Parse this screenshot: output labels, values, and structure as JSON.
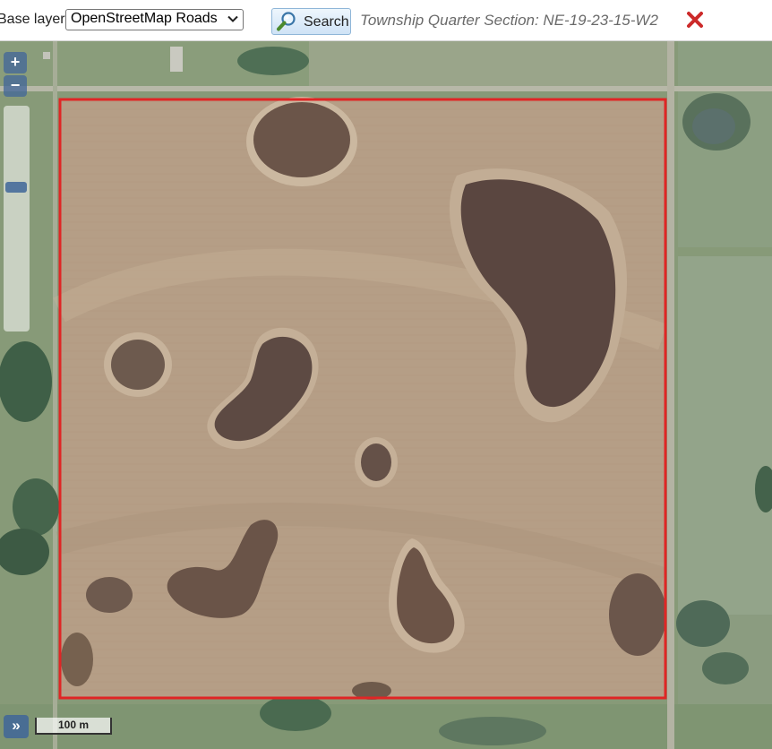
{
  "toolbar": {
    "base_layer_label": "Base layer:",
    "base_layer_selected": "OpenStreetMap Roads",
    "search_label": "Search",
    "section_title": "Township Quarter Section: NE-19-23-15-W2"
  },
  "icons": {
    "search": "magnifier-icon",
    "close": "close-x-icon",
    "select_chevron": "chevron-down-icon"
  },
  "map": {
    "zoom_in_label": "+",
    "zoom_out_label": "−",
    "layer_switcher_label": "»",
    "scale_label": "100 m"
  },
  "colors": {
    "boundary": "#e02525",
    "close_icon": "#cc2a2a",
    "controls": "#406699",
    "section_title": "#6a6a6a"
  }
}
